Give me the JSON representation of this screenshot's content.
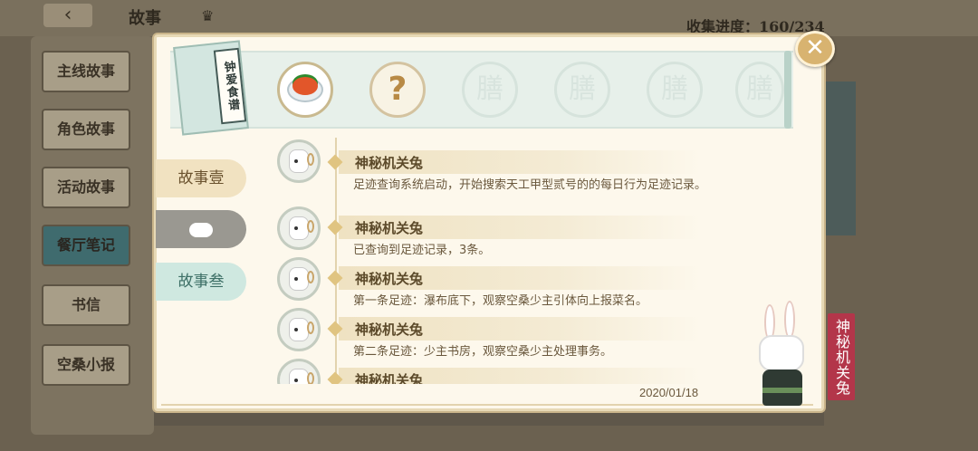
{
  "background": {
    "title": "故事",
    "progress": "收集进度：160/234",
    "sidebar": [
      "主线故事",
      "角色故事",
      "活动故事",
      "餐厅笔记",
      "书信",
      "空桑小报"
    ]
  },
  "book": {
    "title": "钟爱食谱"
  },
  "dish_slots": {
    "unknown": "?",
    "placeholder": "膳"
  },
  "chapters": {
    "tab1": "故事壹",
    "tab3": "故事叁"
  },
  "dialogs": [
    {
      "speaker": "神秘机关兔",
      "text": "足迹查询系统启动，开始搜索天工甲型贰号的的每日行为足迹记录。"
    },
    {
      "speaker": "神秘机关兔",
      "text": "已查询到足迹记录，3条。"
    },
    {
      "speaker": "神秘机关兔",
      "text": "第一条足迹：瀑布底下，观察空桑少主引体向上报菜名。"
    },
    {
      "speaker": "神秘机关兔",
      "text": "第二条足迹：少主书房，观察空桑少主处理事务。"
    },
    {
      "speaker": "神秘机关兔",
      "text": ""
    }
  ],
  "date": "2020/01/18",
  "character": {
    "name": "神秘机关兔"
  },
  "colors": {
    "accent": "#d8b370",
    "name_tag": "#b3364a",
    "band": "#e7f0ea"
  },
  "icons": {
    "close": "close-icon",
    "back": "back-arrow-icon",
    "crown": "crown-icon"
  }
}
